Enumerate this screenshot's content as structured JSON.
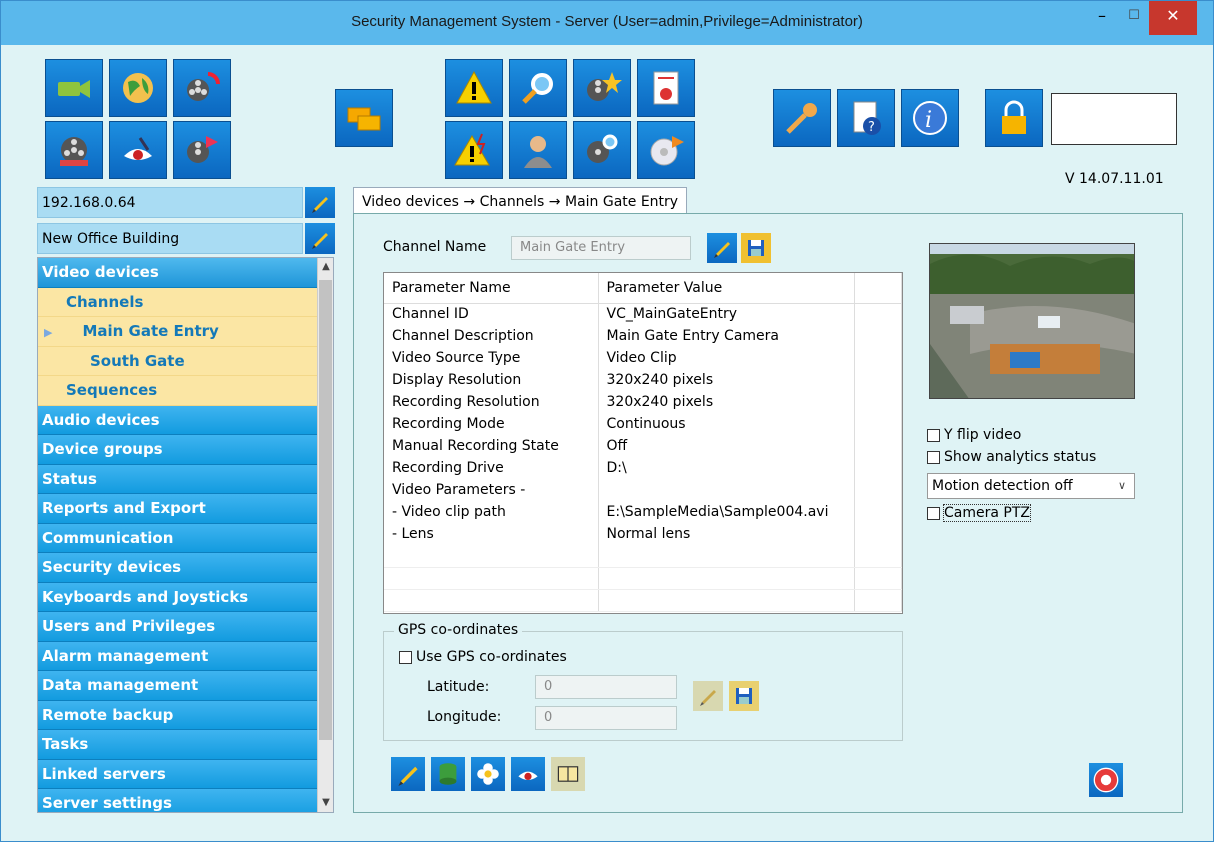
{
  "window": {
    "title": "Security Management System - Server (User=admin,Privilege=Administrator)",
    "min_label": "–",
    "max_label": "☐",
    "close_label": "✕"
  },
  "toolbar": {
    "icons": [
      "camera-icon",
      "globe-icon",
      "film-sync-icon",
      "film-reel-icon",
      "eye-icon",
      "film-export-icon",
      "windows-icon",
      "warning-icon",
      "search-icon",
      "film-star-icon",
      "report-icon",
      "alarm-warning-icon",
      "user-icon",
      "film-search-icon",
      "disc-export-icon",
      "key-icon",
      "help-doc-icon",
      "info-icon",
      "lock-icon"
    ],
    "status_box": ""
  },
  "version": "V 14.07.11.01",
  "server": {
    "address": "192.168.0.64",
    "site": "New Office Building"
  },
  "tree": {
    "items": [
      {
        "label": "Video devices",
        "level": 0
      },
      {
        "label": "Channels",
        "level": 1
      },
      {
        "label": "Main Gate Entry",
        "level": 2
      },
      {
        "label": "South Gate",
        "level": 2
      },
      {
        "label": "Sequences",
        "level": 1
      },
      {
        "label": "Audio devices",
        "level": 0
      },
      {
        "label": "Device groups",
        "level": 0
      },
      {
        "label": "Status",
        "level": 0
      },
      {
        "label": "Reports and Export",
        "level": 0
      },
      {
        "label": "Communication",
        "level": 0
      },
      {
        "label": "Security devices",
        "level": 0
      },
      {
        "label": "Keyboards and Joysticks",
        "level": 0
      },
      {
        "label": "Users and Privileges",
        "level": 0
      },
      {
        "label": "Alarm management",
        "level": 0
      },
      {
        "label": "Data management",
        "level": 0
      },
      {
        "label": "Remote backup",
        "level": 0
      },
      {
        "label": "Tasks",
        "level": 0
      },
      {
        "label": "Linked servers",
        "level": 0
      },
      {
        "label": "Server settings",
        "level": 0
      }
    ]
  },
  "tab": {
    "breadcrumb": "Video devices → Channels → Main Gate Entry"
  },
  "channel": {
    "name_label": "Channel Name",
    "name_value": "Main Gate Entry"
  },
  "params": {
    "headers": [
      "Parameter Name",
      "Parameter Value"
    ],
    "rows": [
      [
        "Channel ID",
        "VC_MainGateEntry"
      ],
      [
        "Channel Description",
        "Main Gate Entry Camera"
      ],
      [
        "Video Source Type",
        "Video Clip"
      ],
      [
        "Display Resolution",
        "320x240 pixels"
      ],
      [
        "Recording Resolution",
        "320x240 pixels"
      ],
      [
        "Recording Mode",
        "Continuous"
      ],
      [
        "Manual Recording State",
        "Off"
      ],
      [
        "Recording Drive",
        "D:\\"
      ],
      [
        "Video Parameters -",
        ""
      ],
      [
        "- Video clip path",
        "E:\\SampleMedia\\Sample004.avi"
      ],
      [
        "- Lens",
        "Normal lens"
      ]
    ]
  },
  "options": {
    "y_flip": "Y flip video",
    "analytics": "Show analytics status",
    "motion": "Motion detection off",
    "ptz": "Camera PTZ"
  },
  "gps": {
    "legend": "GPS co-ordinates",
    "use_label": "Use GPS co-ordinates",
    "lat_label": "Latitude:",
    "lat_value": "0",
    "lon_label": "Longitude:",
    "lon_value": "0"
  }
}
